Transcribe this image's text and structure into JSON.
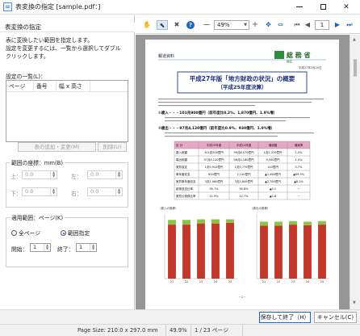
{
  "window": {
    "title": "表変換の指定 [sample.pdf：]",
    "minimize": "–",
    "maximize": "□",
    "close": "✕"
  },
  "left_panel": {
    "header": "表変換の指定",
    "description": [
      "表に変換したい範囲を指定します。",
      "設定を変更するには、一覧から選択してダブル",
      "クリックします。"
    ],
    "list_label": "設定の一覧(L)：",
    "list_columns": [
      "ページ",
      "番号",
      "幅 x 高さ"
    ],
    "add_button": "表の追加・変更(M)",
    "delete_button": "削除(U)",
    "range_group": {
      "legend": "範囲の座標：mm(B)",
      "top_label": "上：",
      "top_value": "0.0",
      "left_label": "左：",
      "left_value": "0.0",
      "bottom_label": "下：",
      "bottom_value": "0.0",
      "right_label": "右：",
      "right_value": "0.0"
    },
    "page_group": {
      "legend": "適用範囲：ページ(K)",
      "all_pages": "全ページ",
      "page_range": "範囲指定",
      "start_label": "開始：",
      "start_value": "1",
      "end_label": "終了：",
      "end_value": "1"
    }
  },
  "toolbar": {
    "zoom": "49%",
    "page": "1"
  },
  "document": {
    "header_left": "報道資料",
    "ministry": "総 務 省",
    "ministry_en": "MIC",
    "date": "平成27年3月20日",
    "title_line1": "平成27年版「地方財政の状況」の概要",
    "title_line2": "（平成25年度決算）",
    "section1": "①歳入・・・101兆900億円（前年度比0.2%、1,870億円、1.9%増）",
    "section2": "②歳出・・・97兆4,120億円（前年度比0.9%、930億円、1.0%増）",
    "table_headers": [
      "区 分",
      "平成25年度",
      "平成24年度",
      "増減額",
      "増減率"
    ],
    "table_rows": [
      [
        "歳入総額",
        "101兆900億円",
        "99兆8,570億円",
        "1兆2,370億円",
        "1.2%"
      ],
      [
        "歳出総額",
        "97兆4,120億円",
        "96兆4,180億円",
        "9,940億円",
        "1.0%"
      ],
      [
        "実質収支",
        "1兆9,910億円",
        "1兆9,770億円",
        "140億円",
        "0.7%"
      ],
      [
        "単年度収支",
        "650億円",
        "2,110億円",
        "▲1,460億円",
        "▲69.3%"
      ],
      [
        "実質単年度収支",
        "3兆1,060億円",
        "3兆3,840億円",
        "▲2,780億円",
        "▲8.2%"
      ],
      [
        "経常収支比率",
        "90.7%",
        "90.8%",
        "▲0.1",
        "－"
      ],
      [
        "実質公債費比率",
        "11.9%",
        "12.7%",
        "▲0.8",
        "－"
      ]
    ],
    "chart_left_label": "（歳入の推移）",
    "chart_right_label": "（歳出の推移）",
    "footer": "－1－"
  },
  "chart_data": [
    {
      "type": "bar",
      "title": "（歳入の推移）",
      "categories": [
        "21",
        "22",
        "23",
        "24",
        "25"
      ],
      "series": [
        {
          "name": "",
          "values": [
            92,
            92,
            94,
            94,
            95
          ]
        },
        {
          "name": "",
          "values": [
            8,
            8,
            7,
            7,
            6
          ]
        }
      ],
      "ylim": [
        0,
        110
      ]
    },
    {
      "type": "bar",
      "title": "（歳出の推移）",
      "categories": [
        "21",
        "22",
        "23",
        "24",
        "25"
      ],
      "series": [
        {
          "name": "",
          "values": [
            90,
            90,
            92,
            91,
            92
          ]
        },
        {
          "name": "",
          "values": [
            7,
            7,
            6,
            6,
            6
          ]
        }
      ],
      "ylim": [
        0,
        110
      ]
    }
  ],
  "buttons": {
    "ok": "保存して終了（H）",
    "cancel": "キャンセル(C)"
  },
  "status": {
    "page_size": "Page Size: 210.0 x 297.0 mm",
    "zoom": "49.9%",
    "page_count": "1 / 23 ページ"
  },
  "colors": {
    "accent": "#1c64c6",
    "bar_red": "#c0392b",
    "bar_green": "#8bc34a"
  }
}
